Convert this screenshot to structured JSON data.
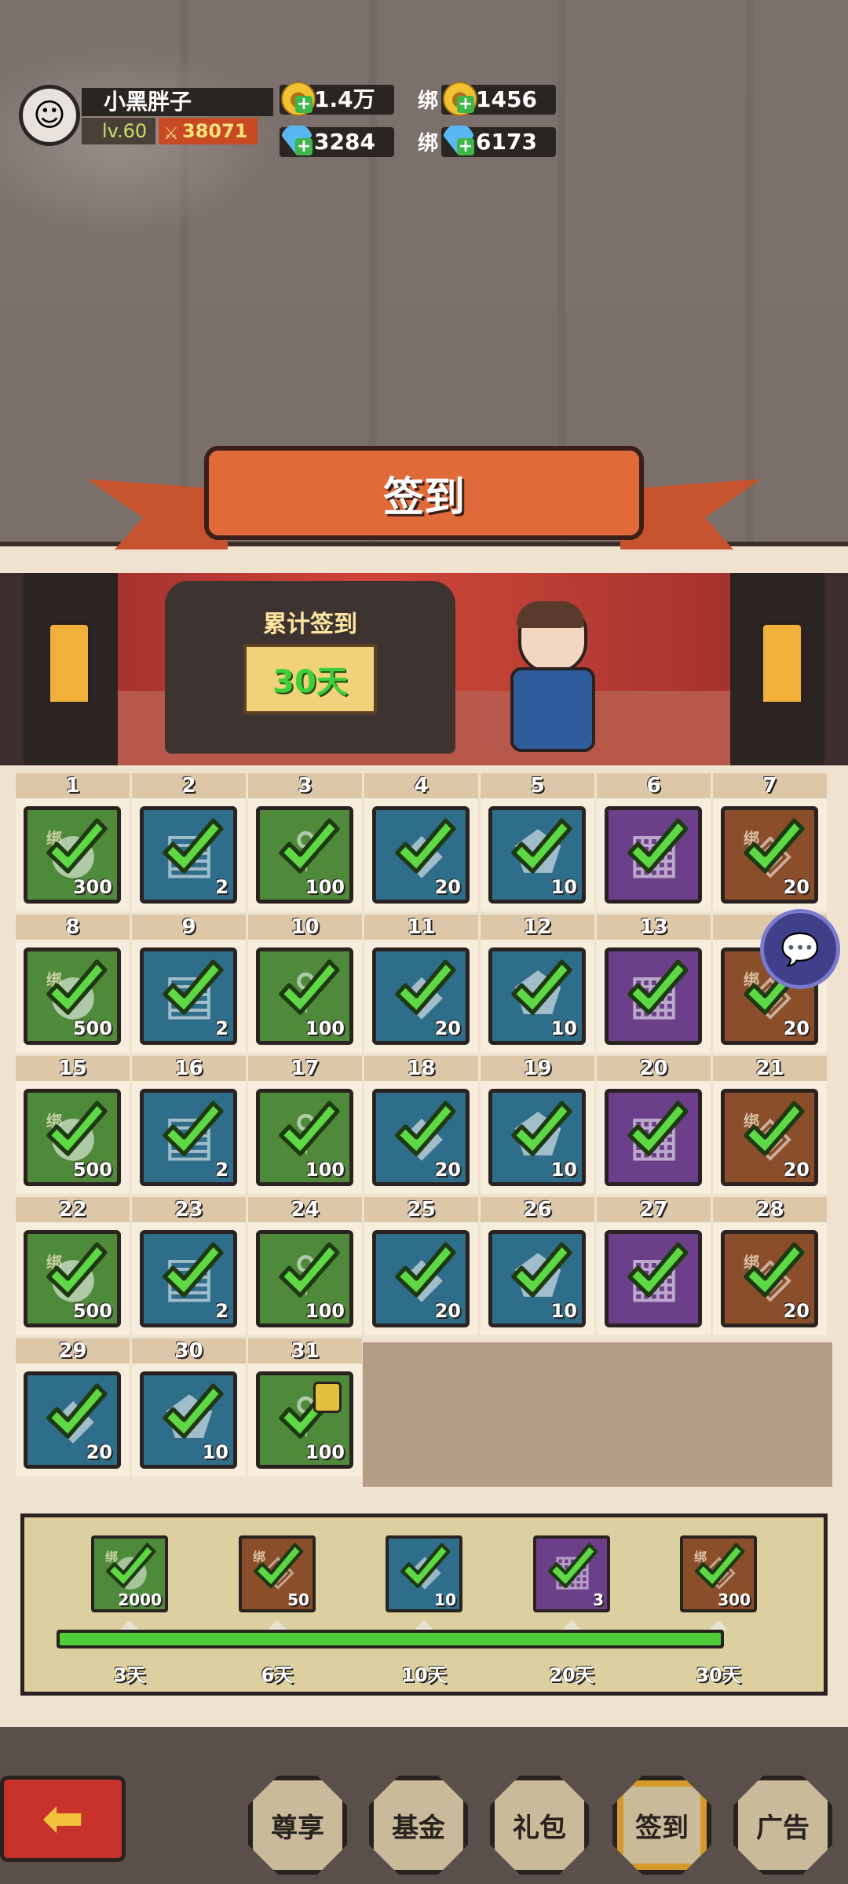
{
  "player": {
    "name": "小黑胖子",
    "level": "lv.60",
    "power": "38071"
  },
  "resources": {
    "gold": "1.4万",
    "bound_label": "绑",
    "bound_gold": "1456",
    "diamond": "3284",
    "bound_diamond": "6173"
  },
  "title": "签到",
  "cumulative": {
    "label": "累计签到",
    "days": "30天"
  },
  "days": [
    {
      "day": "1",
      "color": "green",
      "item": "gold-coin-icon",
      "qty": "300",
      "bound": true
    },
    {
      "day": "2",
      "color": "blue",
      "item": "scroll-icon",
      "qty": "2",
      "bound": false
    },
    {
      "day": "3",
      "color": "green",
      "item": "ore-icon",
      "qty": "100",
      "bound": false
    },
    {
      "day": "4",
      "color": "blue",
      "item": "crystal-icon",
      "qty": "20",
      "bound": false
    },
    {
      "day": "5",
      "color": "blue",
      "item": "stone-icon",
      "qty": "10",
      "bound": false
    },
    {
      "day": "6",
      "color": "purple",
      "item": "chest-icon",
      "qty": "",
      "bound": false
    },
    {
      "day": "7",
      "color": "brown",
      "item": "gem-icon",
      "qty": "20",
      "bound": true
    },
    {
      "day": "8",
      "color": "green",
      "item": "gold-coin-icon",
      "qty": "500",
      "bound": true
    },
    {
      "day": "9",
      "color": "blue",
      "item": "scroll-icon",
      "qty": "2",
      "bound": false
    },
    {
      "day": "10",
      "color": "green",
      "item": "ore-icon",
      "qty": "100",
      "bound": false
    },
    {
      "day": "11",
      "color": "blue",
      "item": "crystal-icon",
      "qty": "20",
      "bound": false
    },
    {
      "day": "12",
      "color": "blue",
      "item": "stone-icon",
      "qty": "10",
      "bound": false
    },
    {
      "day": "13",
      "color": "purple",
      "item": "chest-icon",
      "qty": "",
      "bound": false
    },
    {
      "day": "",
      "color": "brown",
      "item": "gem-icon",
      "qty": "20",
      "bound": true
    },
    {
      "day": "15",
      "color": "green",
      "item": "gold-coin-icon",
      "qty": "500",
      "bound": true
    },
    {
      "day": "16",
      "color": "blue",
      "item": "scroll-icon",
      "qty": "2",
      "bound": false
    },
    {
      "day": "17",
      "color": "green",
      "item": "ore-icon",
      "qty": "100",
      "bound": false
    },
    {
      "day": "18",
      "color": "blue",
      "item": "crystal-icon",
      "qty": "20",
      "bound": false
    },
    {
      "day": "19",
      "color": "blue",
      "item": "stone-icon",
      "qty": "10",
      "bound": false
    },
    {
      "day": "20",
      "color": "purple",
      "item": "chest-icon",
      "qty": "",
      "bound": false
    },
    {
      "day": "21",
      "color": "brown",
      "item": "gem-icon",
      "qty": "20",
      "bound": true
    },
    {
      "day": "22",
      "color": "green",
      "item": "gold-coin-icon",
      "qty": "500",
      "bound": true
    },
    {
      "day": "23",
      "color": "blue",
      "item": "scroll-icon",
      "qty": "2",
      "bound": false
    },
    {
      "day": "24",
      "color": "green",
      "item": "ore-icon",
      "qty": "100",
      "bound": false
    },
    {
      "day": "25",
      "color": "blue",
      "item": "crystal-icon",
      "qty": "20",
      "bound": false
    },
    {
      "day": "26",
      "color": "blue",
      "item": "stone-icon",
      "qty": "10",
      "bound": false
    },
    {
      "day": "27",
      "color": "purple",
      "item": "chest-icon",
      "qty": "",
      "bound": false
    },
    {
      "day": "28",
      "color": "brown",
      "item": "gem-icon",
      "qty": "20",
      "bound": true
    },
    {
      "day": "29",
      "color": "blue",
      "item": "crystal-icon",
      "qty": "20",
      "bound": false
    },
    {
      "day": "30",
      "color": "blue",
      "item": "stone-icon",
      "qty": "10",
      "bound": false
    },
    {
      "day": "31",
      "color": "green",
      "item": "ore-icon",
      "qty": "100",
      "bound": false,
      "locked": true
    }
  ],
  "milestones": [
    {
      "label": "3天",
      "color": "green",
      "item": "gold-coin-icon",
      "qty": "2000",
      "bound": true
    },
    {
      "label": "6天",
      "color": "brown",
      "item": "gem-icon",
      "qty": "50",
      "bound": true
    },
    {
      "label": "10天",
      "color": "blue",
      "item": "crystal-icon",
      "qty": "10",
      "bound": false
    },
    {
      "label": "20天",
      "color": "purple",
      "item": "chest-icon",
      "qty": "3",
      "bound": false
    },
    {
      "label": "30天",
      "color": "brown",
      "item": "gem-icon",
      "qty": "300",
      "bound": true
    }
  ],
  "progress_fraction": 1.0,
  "nav": [
    "尊享",
    "基金",
    "礼包",
    "签到",
    "广告"
  ],
  "nav_active": "签到"
}
